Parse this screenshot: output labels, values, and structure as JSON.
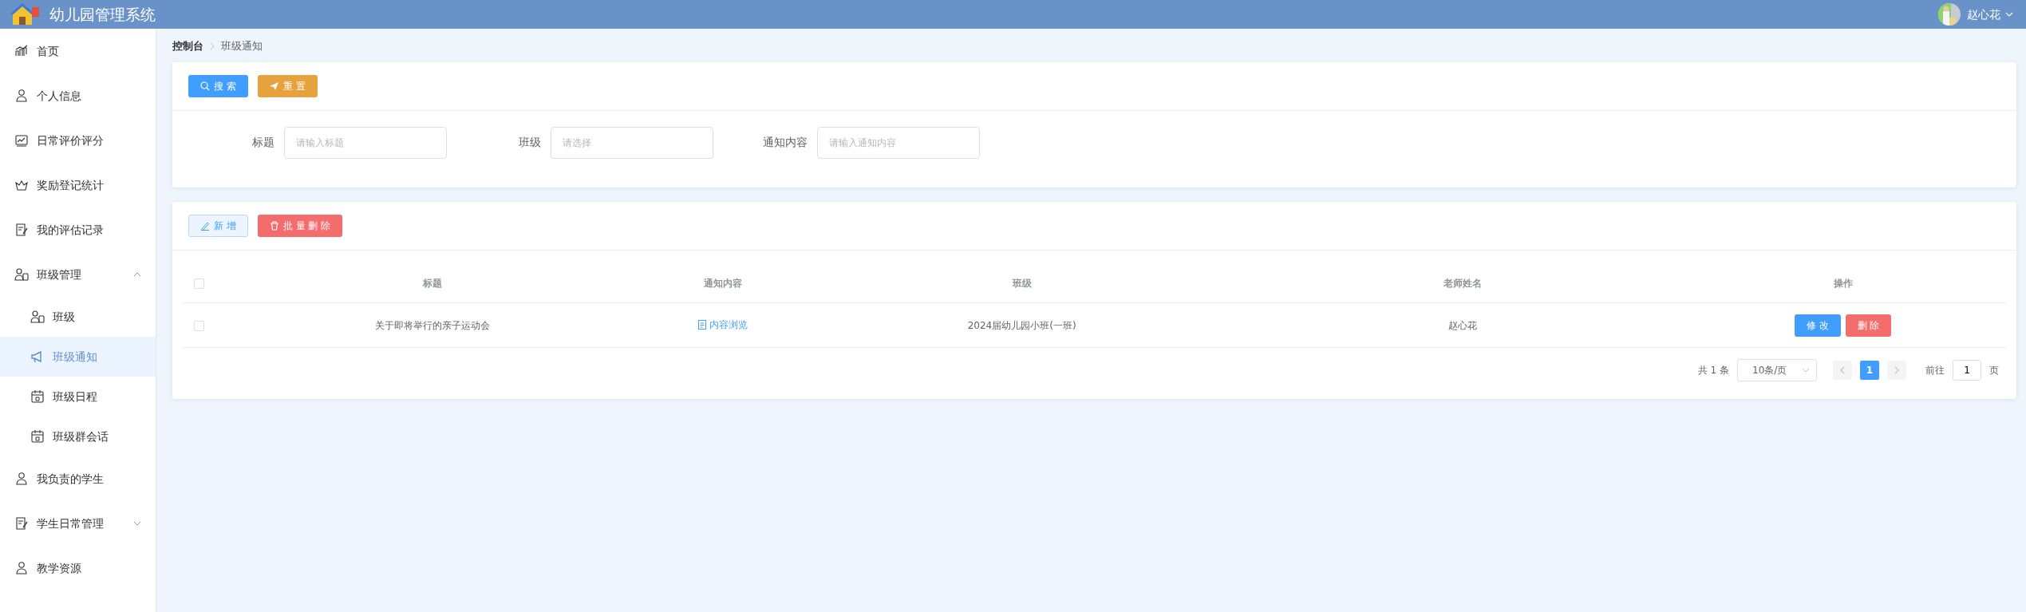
{
  "header": {
    "title": "幼儿园管理系统",
    "user": "赵心花"
  },
  "sidebar": {
    "items": [
      {
        "label": "首页",
        "kind": "chart",
        "selected": false
      },
      {
        "label": "个人信息",
        "kind": "person",
        "selected": false
      },
      {
        "label": "日常评价评分",
        "kind": "board",
        "selected": false
      },
      {
        "label": "奖励登记统计",
        "kind": "crown",
        "selected": false
      },
      {
        "label": "我的评估记录",
        "kind": "note",
        "selected": false
      },
      {
        "label": "班级管理",
        "kind": "group",
        "selected": false,
        "expanded": true,
        "children": [
          {
            "label": "班级",
            "kind": "group",
            "selected": false
          },
          {
            "label": "班级通知",
            "kind": "megaphone",
            "selected": true
          },
          {
            "label": "班级日程",
            "kind": "calendar",
            "selected": false
          },
          {
            "label": "班级群会话",
            "kind": "calendar",
            "selected": false
          }
        ]
      },
      {
        "label": "我负责的学生",
        "kind": "person",
        "selected": false
      },
      {
        "label": "学生日常管理",
        "kind": "note",
        "selected": false,
        "expanded": false
      },
      {
        "label": "教学资源",
        "kind": "person",
        "selected": false
      }
    ]
  },
  "breadcrumb": [
    "控制台",
    "班级通知"
  ],
  "search": {
    "buttons": [
      {
        "label": "搜 索",
        "kind": "search"
      },
      {
        "label": "重 置",
        "kind": "reset"
      }
    ],
    "fields": [
      {
        "label": "标题",
        "placeholder": "请输入标题"
      },
      {
        "label": "班级",
        "placeholder": "请选择"
      },
      {
        "label": "通知内容",
        "placeholder": "请输入通知内容"
      }
    ]
  },
  "toolbar": {
    "buttons": [
      {
        "label": "新 增",
        "kind": "add"
      },
      {
        "label": "批 量 删 除",
        "kind": "delete"
      }
    ]
  },
  "table": {
    "columns": [
      "标题",
      "通知内容",
      "班级",
      "老师姓名",
      "操作"
    ],
    "rows": [
      {
        "checked": false,
        "title": "关于即将举行的亲子运动会",
        "content_link": "内容浏览",
        "class": "2024届幼儿园小班(一班)",
        "teacher": "赵心花",
        "actions": [
          "修 改",
          "删 除"
        ]
      }
    ],
    "header_checked": false
  },
  "pagination": {
    "total": "共 1 条",
    "page_size": "10条/页",
    "pages": [
      {
        "label": "1",
        "selected": true
      }
    ],
    "goto_label": "前往",
    "goto_value": "1",
    "goto_suffix": "页"
  }
}
